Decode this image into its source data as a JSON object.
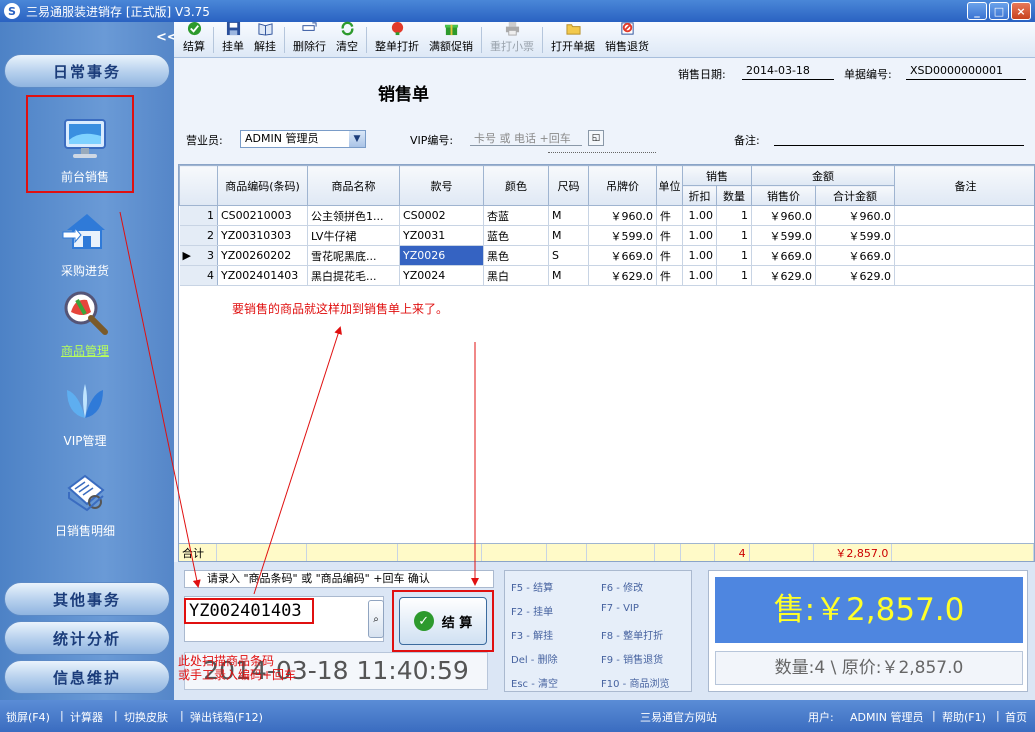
{
  "window": {
    "title": "三易通服装进销存 [正式版] V3.75",
    "min": "_",
    "max": "□",
    "close": "×"
  },
  "sidebar": {
    "collapse": "<<",
    "sections": {
      "daily": "日常事务",
      "other": "其他事务",
      "stats": "统计分析",
      "info": "信息维护"
    },
    "items": [
      {
        "label": "前台销售",
        "icon": "monitor-icon"
      },
      {
        "label": "采购进货",
        "icon": "house-icon"
      },
      {
        "label": "商品管理",
        "icon": "magnifier-icon"
      },
      {
        "label": "VIP管理",
        "icon": "butterfly-icon"
      },
      {
        "label": "日销售明细",
        "icon": "report-icon"
      }
    ]
  },
  "toolbar": {
    "buttons": [
      {
        "label": "结算"
      },
      {
        "label": "挂单"
      },
      {
        "label": "解挂"
      },
      {
        "label": "删除行"
      },
      {
        "label": "清空"
      },
      {
        "label": "整单打折"
      },
      {
        "label": "满额促销"
      },
      {
        "label": "重打小票"
      },
      {
        "label": "打开单据"
      },
      {
        "label": "销售退货"
      }
    ]
  },
  "form": {
    "title": "销售单",
    "date_label": "销售日期:",
    "date_value": "2014-03-18",
    "no_label": "单据编号:",
    "no_value": "XSD0000000001",
    "clerk_label": "营业员:",
    "clerk_value": "ADMIN 管理员",
    "vip_label": "VIP编号:",
    "vip_placeholder": "卡号 或 电话 +回车",
    "note_label": "备注:"
  },
  "grid": {
    "headers": {
      "code": "商品编码(条码)",
      "name": "商品名称",
      "style": "款号",
      "color": "颜色",
      "size": "尺码",
      "tag_price": "吊牌价",
      "unit": "单位",
      "sale": "销售",
      "discount": "折扣",
      "qty": "数量",
      "amount": "金额",
      "sale_price": "销售价",
      "total": "合计金额",
      "remark": "备注"
    },
    "rows": [
      {
        "idx": "1",
        "code": "CS00210003",
        "name": "公主领拼色1...",
        "style": "CS0002",
        "color": "杏蓝",
        "size": "M",
        "tag_price": "￥960.0",
        "unit": "件",
        "discount": "1.00",
        "qty": "1",
        "sale_price": "￥960.0",
        "total": "￥960.0",
        "remark": ""
      },
      {
        "idx": "2",
        "code": "YZ00310303",
        "name": "LV牛仔裙",
        "style": "YZ0031",
        "color": "蓝色",
        "size": "M",
        "tag_price": "￥599.0",
        "unit": "件",
        "discount": "1.00",
        "qty": "1",
        "sale_price": "￥599.0",
        "total": "￥599.0",
        "remark": ""
      },
      {
        "idx": "3",
        "code": "YZ00260202",
        "name": "雪花呢黑底...",
        "style": "YZ0026",
        "color": "黑色",
        "size": "S",
        "tag_price": "￥669.0",
        "unit": "件",
        "discount": "1.00",
        "qty": "1",
        "sale_price": "￥669.0",
        "total": "￥669.0",
        "remark": ""
      },
      {
        "idx": "4",
        "code": "YZ002401403",
        "name": "黑白提花毛...",
        "style": "YZ0024",
        "color": "黑白",
        "size": "M",
        "tag_price": "￥629.0",
        "unit": "件",
        "discount": "1.00",
        "qty": "1",
        "sale_price": "￥629.0",
        "total": "￥629.0",
        "remark": ""
      }
    ],
    "total_label": "合计",
    "total_qty": "4",
    "total_amount": "￥2,857.0",
    "annotation": "要销售的商品就这样加到销售单上来了。"
  },
  "bottom": {
    "prompt": "请录入 \"商品条码\" 或 \"商品编码\" +回车 确认",
    "scan_value": "YZ002401403",
    "settle_label": "结 算",
    "scan_note_1": "此处扫描商品条码",
    "scan_note_2": "或手工录入编码+回车",
    "clock": "2014-03-18 11:40:59",
    "keys": [
      "F5 - 结算",
      "F6 - 修改",
      "F2 - 挂单",
      "F7 - VIP",
      "F3 - 解挂",
      "F8 - 整单打折",
      "Del - 删除",
      "F9 - 销售退货",
      "Esc - 清空",
      "F10 - 商品浏览"
    ],
    "sale_text": "售:￥2,857.0",
    "qty_text": "数量:4 \\ 原价:￥2,857.0"
  },
  "status": {
    "lock": "锁屏(F4)",
    "calc": "计算器",
    "skin": "切换皮肤",
    "drawer": "弹出钱箱(F12)",
    "site": "三易通官方网站",
    "user_label": "用户:",
    "user_value": "ADMIN 管理员",
    "help": "帮助(F1)",
    "home": "首页"
  },
  "colors": {
    "accent": "#3563c2",
    "annotation_red": "#e01010",
    "sale_yellow": "#ffff28"
  }
}
